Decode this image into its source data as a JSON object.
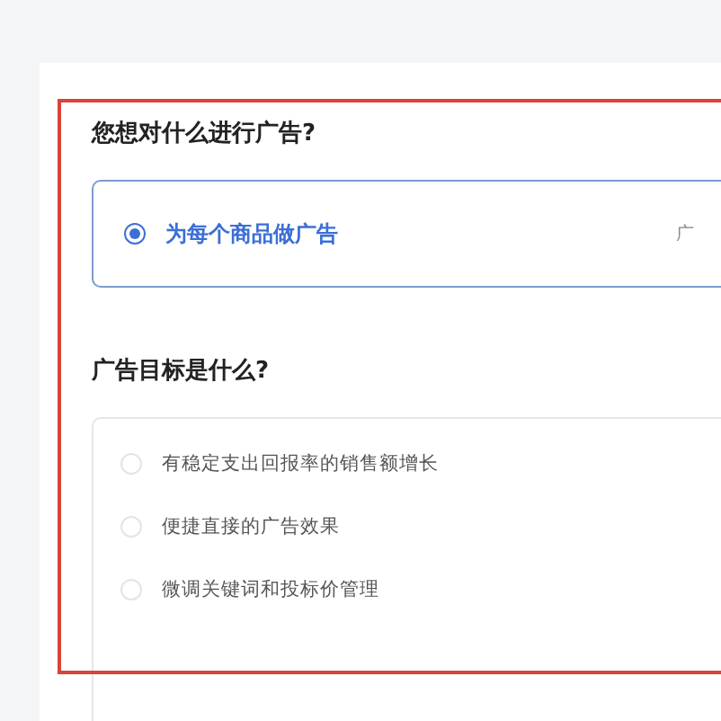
{
  "ad_target": {
    "question": "您想对什么进行广告?",
    "options": [
      {
        "label": "为每个商品做广告",
        "selected": true,
        "note": "广"
      }
    ]
  },
  "ad_goal": {
    "question": "广告目标是什么?",
    "options": [
      {
        "label": "有稳定支出回报率的销售额增长",
        "selected": false
      },
      {
        "label": "便捷直接的广告效果",
        "selected": false
      },
      {
        "label": "微调关键词和投标价管理",
        "selected": false
      }
    ]
  }
}
